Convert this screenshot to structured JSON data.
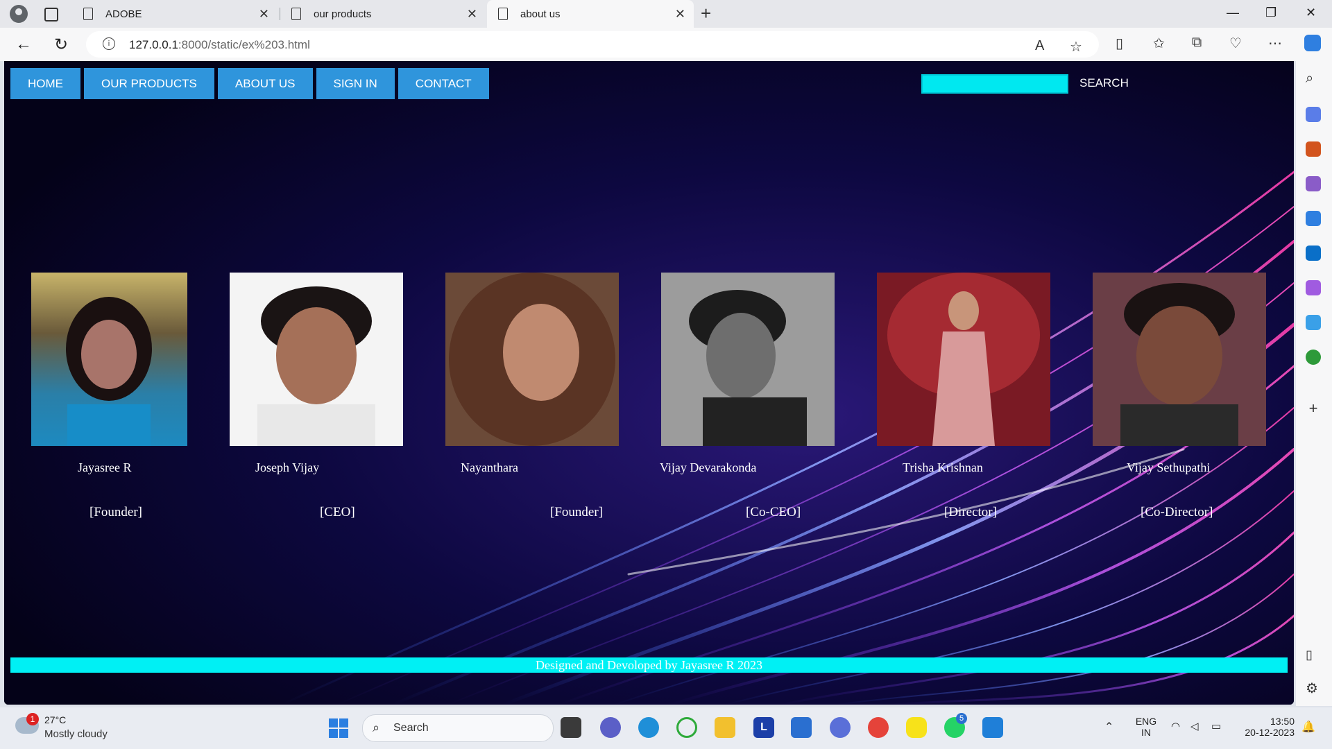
{
  "browser": {
    "tabs": [
      {
        "title": "ADOBE"
      },
      {
        "title": "our products"
      },
      {
        "title": "about us"
      }
    ],
    "url_host": "127.0.0.1",
    "url_rest": ":8000/static/ex%203.html"
  },
  "page": {
    "nav": [
      "HOME",
      "OUR PRODUCTS",
      "ABOUT US",
      "SIGN IN",
      "CONTACT"
    ],
    "search_label": "SEARCH",
    "search_value": "",
    "team": [
      {
        "name": "Jayasree R",
        "role": "[Founder]"
      },
      {
        "name": "Joseph Vijay",
        "role": "[CEO]"
      },
      {
        "name": "Nayanthara",
        "role": "[Founder]"
      },
      {
        "name": "Vijay Devarakonda",
        "role": "[Co-CEO]"
      },
      {
        "name": "Trisha Krishnan",
        "role": "[Director]"
      },
      {
        "name": "Vijay Sethupathi",
        "role": "[Co-Director]"
      }
    ],
    "footer": "Designed and Devoloped by Jayasree R 2023"
  },
  "taskbar": {
    "weather_badge": "1",
    "temperature": "27°C",
    "weather": "Mostly cloudy",
    "search": "Search",
    "whatsapp_badge": "5",
    "lang": "ENG",
    "region": "IN",
    "time": "13:50",
    "date": "20-12-2023"
  },
  "colors": {
    "nav_button": "#2f95dc",
    "accent_cyan": "#00f0f4",
    "page_background": "#050320"
  }
}
